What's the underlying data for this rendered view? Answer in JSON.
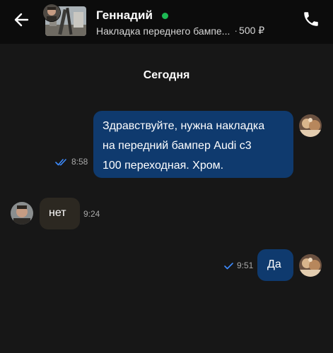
{
  "header": {
    "seller_name": "Геннадий",
    "item_title": "Накладка переднего бампе...",
    "item_price_sep": "·",
    "item_price": "500 ₽",
    "online_color": "#1db954",
    "back_icon": "arrow-left-icon",
    "call_icon": "phone-icon"
  },
  "chat": {
    "date_label": "Сегодня",
    "messages": [
      {
        "direction": "outgoing",
        "lines": [
          "Здравствуйте, нужна накладка",
          "на передний бампер Audi с3",
          "100 переходная. Хром."
        ],
        "time": "8:58",
        "status": "read"
      },
      {
        "direction": "incoming",
        "lines": [
          "нет"
        ],
        "time": "9:24"
      },
      {
        "direction": "outgoing",
        "lines": [
          "Да"
        ],
        "time": "9:51",
        "status": "delivered"
      }
    ]
  },
  "colors": {
    "background": "#171717",
    "header": "#0c0c0c",
    "outgoing_bubble": "#0f3a6e",
    "incoming_bubble": "#2c2821",
    "check_color": "#3d8bfd"
  }
}
